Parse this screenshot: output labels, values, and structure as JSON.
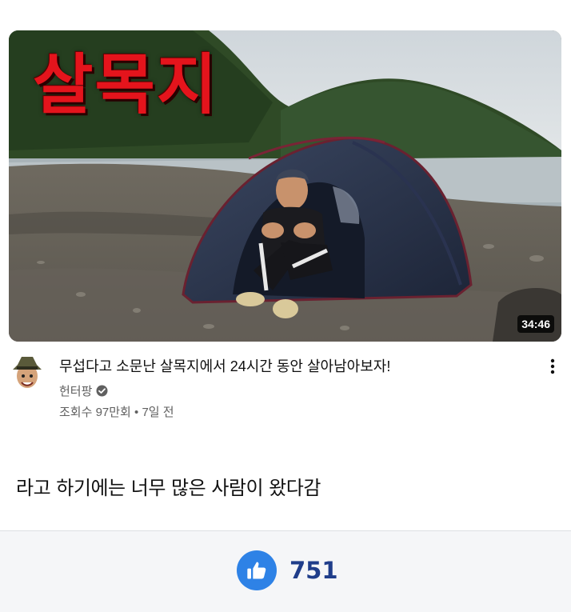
{
  "video": {
    "thumbnail_text": "살목지",
    "duration": "34:46",
    "title": "무섭다고 소문난 살목지에서 24시간 동안 살아남아보자!",
    "channel_name": "헌터팡",
    "verified": true,
    "views": "조회수 97만회",
    "separator": "•",
    "age": "7일 전"
  },
  "post": {
    "text": "라고 하기에는 너무 많은 사람이 왔다감"
  },
  "reactions": {
    "like_count": "751",
    "like_color": "#2e82e6"
  },
  "icons": {
    "avatar": "channel-avatar",
    "verified": "verified-check-icon",
    "more": "more-vert-icon",
    "like": "thumbs-up-icon"
  }
}
